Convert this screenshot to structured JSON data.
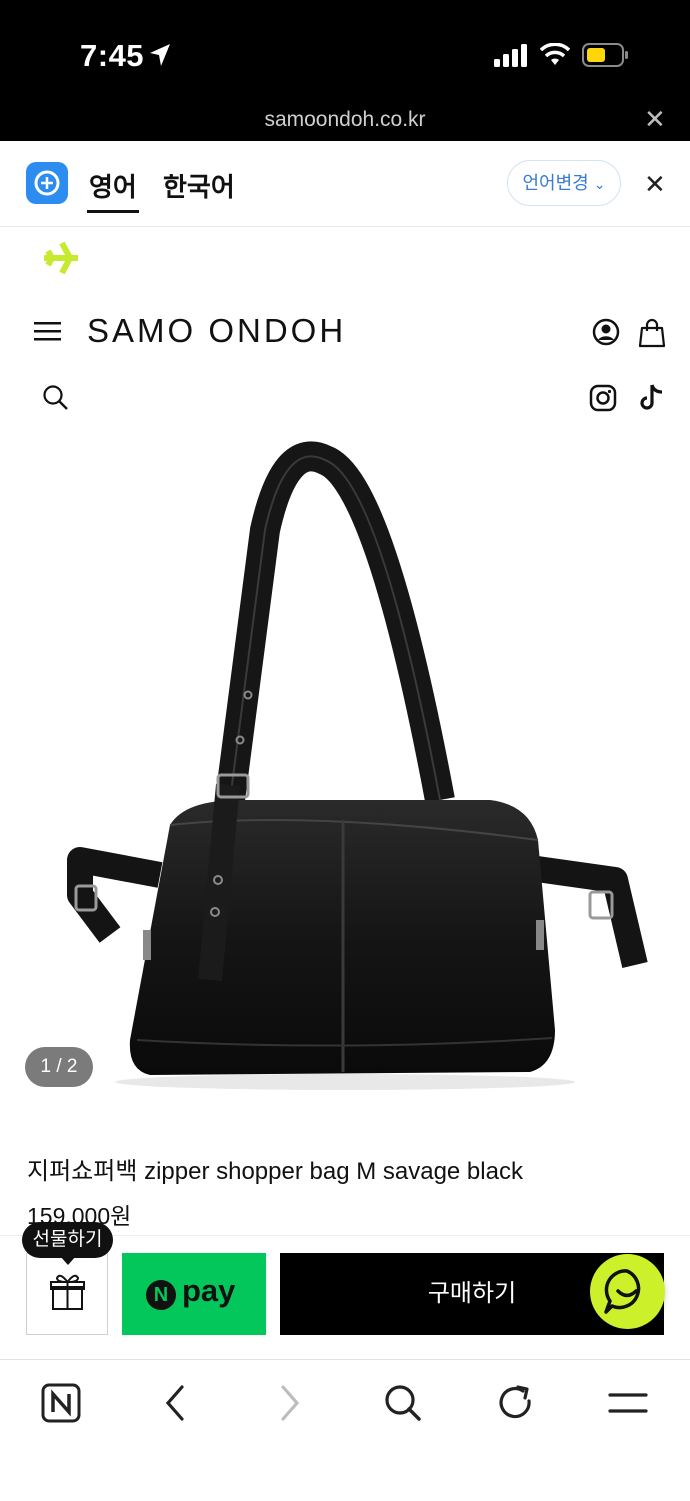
{
  "status_bar": {
    "time": "7:45",
    "domain": "samoondoh.co.kr"
  },
  "translate_bar": {
    "tab_english": "영어",
    "tab_korean": "한국어",
    "change_language": "언어변경",
    "selected_tab": "영어"
  },
  "header": {
    "brand": "SAMO ONDOH",
    "icons": [
      "plane-icon",
      "menu-icon",
      "user-icon",
      "shopping-bag-icon",
      "search-icon",
      "instagram-icon",
      "tiktok-icon"
    ]
  },
  "gallery": {
    "counter": "1 / 2"
  },
  "product": {
    "title": "지퍼쇼퍼백 zipper shopper bag M savage black",
    "price": "159,000원"
  },
  "purchase_bar": {
    "gift_tooltip": "선물하기",
    "npay_label": "pay",
    "npay_badge": "N",
    "buy_label": "구매하기"
  },
  "browser_toolbar": {
    "icons": [
      "naver-home-icon",
      "back-icon",
      "forward-icon",
      "search-icon",
      "refresh-icon",
      "menu-icon"
    ]
  },
  "colors": {
    "npay_green": "#03c75a",
    "chat_lime": "#ccf12a",
    "plane_lime": "#c8ea2e",
    "translate_blue": "#2d8cf0"
  }
}
